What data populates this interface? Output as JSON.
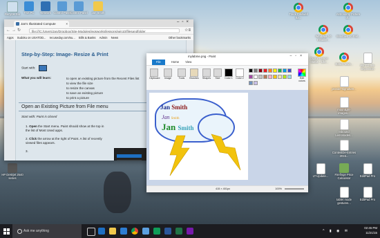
{
  "desktop": {
    "icons_left": [
      {
        "label": "Recycle Bin"
      },
      {
        "label": "This PC"
      },
      {
        "label": "Network"
      },
      {
        "label": "Control Panel"
      },
      {
        "label": "Control Panel"
      },
      {
        "label": "Jan Smith"
      },
      {
        "label": "HP Deskjet 2540 series"
      }
    ],
    "icons_right": [
      {
        "label": "Track Coldwell Ba..."
      },
      {
        "label": "Astronomy Picture of..."
      },
      {
        "label": "Windows 10 Installer..."
      },
      {
        "label": "Windows 10 Fall..."
      },
      {
        "label": "Digital Lemon Status - Life..."
      },
      {
        "label": "status.news..."
      },
      {
        "label": "WinTD-Ins-disposition"
      },
      {
        "label": "janvide-signature..."
      },
      {
        "label": "moonlight-images..."
      },
      {
        "label": "Inbound Lemonades..."
      },
      {
        "label": "ContestDe-Entries 2015..."
      },
      {
        "label": "EditPad Pro"
      },
      {
        "label": "LT-Update..."
      },
      {
        "label": "Firefinge Price Calculator"
      },
      {
        "label": "tablet mode gestures..."
      },
      {
        "label": "EditPad Pro"
      }
    ]
  },
  "chrome": {
    "tab_title": "Jan's Illustrated Compute",
    "url": "file:///C:/Users/Jan/Dropbox/Site-Modules/jegsworks/lessons/win10/filesandfolder",
    "bookmarks": [
      "Apps",
      "Sudoku on USATOD...",
      "recuseday.com/su...",
      "Bills & Banks",
      "Admin",
      "News"
    ],
    "other_bookmarks": "Other bookmarks",
    "page": {
      "heading": "Step-by-Step: Image- Resize & Print",
      "start_with": "Start with:",
      "learn_label": "What you will learn:",
      "learn_items": [
        "to open an existing picture from the Recent Files list",
        "to view the file size",
        "to resize the canvas",
        "to save an existing picture",
        "to print a picture"
      ],
      "section_heading": "Open an Existing Picture from File menu",
      "start_with_2": "Start with: Paint is closed",
      "step1_num": "1.",
      "step1_bold": "Open",
      "step1_text": "the Start menu. Paint should show at the top in the list of Most Used apps.",
      "step2_num": "2.",
      "step2_bold": "Click",
      "step2_text": "the arrow at the right of Paint. A list of recently viewed files appears.",
      "step3_num": "3."
    }
  },
  "paint": {
    "title": "mylabme.png - Paint",
    "tabs": [
      "File",
      "Home",
      "View"
    ],
    "ribbon_labels": [
      "Clipboard",
      "Image",
      "Tools",
      "Brushes",
      "Shapes",
      "Size",
      "Color 1",
      "Color 2",
      "Edit colors"
    ],
    "canvas_text": {
      "line1_a": "Jan ",
      "line1_b": "Smith",
      "line2_a": "Jan ",
      "line2_b": "Smith",
      "line3_a": "Jan ",
      "line3_b": "Smith"
    },
    "status_size": "415 × 401px",
    "zoom": "100%",
    "swatch_colors": [
      "#000000",
      "#7f7f7f",
      "#880015",
      "#ed1c24",
      "#ff7f27",
      "#fff200",
      "#22b14c",
      "#00a2e8",
      "#3f48cc",
      "#a349a4",
      "#ffffff",
      "#c3c3c3",
      "#b97a57",
      "#ffaec9",
      "#ffc90e",
      "#efe4b0",
      "#b5e61d",
      "#99d9ea",
      "#7092be",
      "#c8bfe7"
    ]
  },
  "taskbar": {
    "search_placeholder": "Ask me anything",
    "time": "02:45 PM",
    "date": "11/21/15"
  }
}
